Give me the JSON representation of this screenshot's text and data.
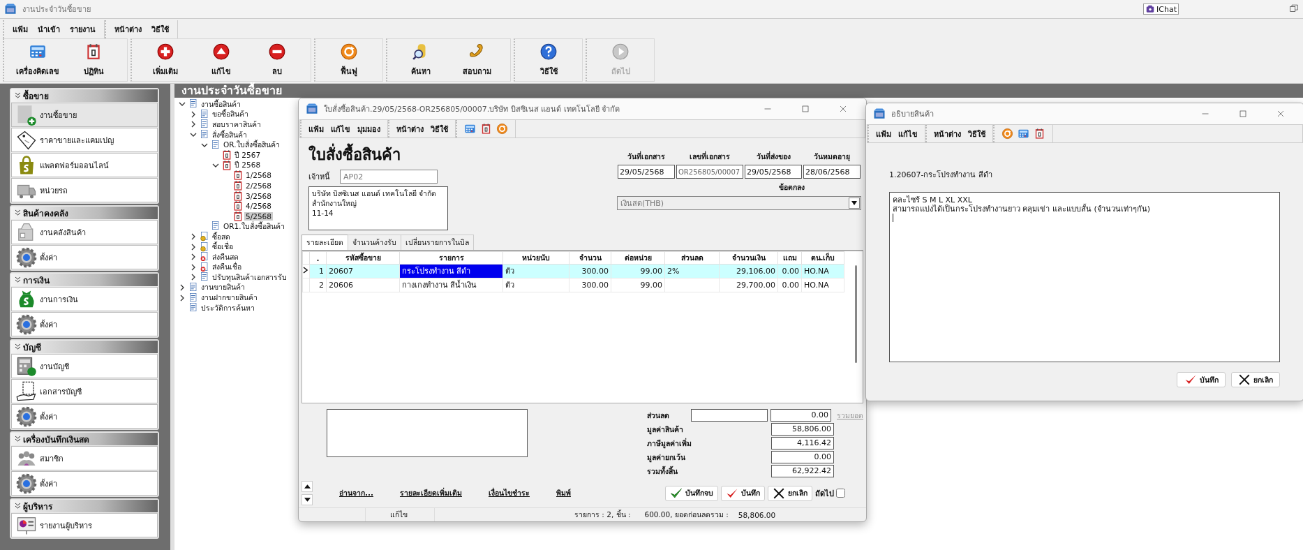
{
  "window": {
    "title": "งานประจำวันซื้อขาย",
    "chat_label": "IChat"
  },
  "menu_groups": [
    [
      "แฟ้ม",
      "นำเข้า",
      "รายงาน"
    ],
    [
      "หน้าต่าง",
      "วิธีใช้"
    ]
  ],
  "toolbar_groups": [
    [
      {
        "label": "เครื่องคิดเลข",
        "kind": "calculator",
        "disabled": false
      },
      {
        "label": "ปฏิทิน",
        "kind": "calendar",
        "disabled": false
      }
    ],
    [
      {
        "label": "เพิ่มเติม",
        "kind": "add",
        "disabled": false
      },
      {
        "label": "แก้ไข",
        "kind": "edit",
        "disabled": false
      },
      {
        "label": "ลบ",
        "kind": "delete",
        "disabled": false
      }
    ],
    [
      {
        "label": "ฟื้นฟู",
        "kind": "refresh",
        "disabled": false
      }
    ],
    [
      {
        "label": "ค้นหา",
        "kind": "search",
        "disabled": false
      },
      {
        "label": "สอบถาม",
        "kind": "phone",
        "disabled": false
      }
    ],
    [
      {
        "label": "วิธีใช้",
        "kind": "help",
        "disabled": false
      }
    ],
    [
      {
        "label": "ถัดไป",
        "kind": "next",
        "disabled": true
      }
    ]
  ],
  "sidebar": {
    "sections": [
      {
        "title": "ซื้อขาย",
        "items": [
          {
            "label": "งานซื้อขาย",
            "kind": "sale",
            "selected": true
          },
          {
            "label": "ราคาขายและแคมเปญ",
            "kind": "tag",
            "selected": false
          },
          {
            "label": "แพลตฟอร์มออนไลน์",
            "kind": "bag",
            "selected": false
          },
          {
            "label": "หน่วยรถ",
            "kind": "truck",
            "selected": false
          }
        ]
      },
      {
        "title": "สินค้าคงคลัง",
        "items": [
          {
            "label": "งานคลังสินค้า",
            "kind": "warehouse",
            "selected": false
          },
          {
            "label": "ตั้งค่า",
            "kind": "gear",
            "selected": false
          }
        ]
      },
      {
        "title": "การเงิน",
        "items": [
          {
            "label": "งานการเงิน",
            "kind": "money",
            "selected": false
          },
          {
            "label": "ตั้งค่า",
            "kind": "gear",
            "selected": false
          }
        ]
      },
      {
        "title": "บัญชี",
        "items": [
          {
            "label": "งานบัญชี",
            "kind": "ledger",
            "selected": false
          },
          {
            "label": "เอกสารบัญชี",
            "kind": "document",
            "selected": false
          },
          {
            "label": "ตั้งค่า",
            "kind": "gear",
            "selected": false
          }
        ]
      },
      {
        "title": "เครื่องบันทึกเงินสด",
        "items": [
          {
            "label": "สมาชิก",
            "kind": "members",
            "selected": false
          },
          {
            "label": "ตั้งค่า",
            "kind": "gear",
            "selected": false
          }
        ]
      },
      {
        "title": "ผู้บริหาร",
        "items": [
          {
            "label": "รายงานผู้บริหาร",
            "kind": "chart",
            "selected": false
          }
        ]
      }
    ]
  },
  "main_header": "งานประจำวันซื้อขาย",
  "tree": [
    {
      "label": "งานซื้อสินค้า",
      "kind": "doc",
      "expanded": true,
      "selected": false,
      "children": [
        {
          "label": "ขอซื้อสินค้า",
          "kind": "doc",
          "expanded": false,
          "selected": false
        },
        {
          "label": "สอบราคาสินค้า",
          "kind": "doc",
          "expanded": false,
          "selected": false
        },
        {
          "label": "สั่งซื้อสินค้า",
          "kind": "doc",
          "expanded": true,
          "selected": false,
          "children": [
            {
              "label": "OR.ใบสั่งซื้อสินค้า",
              "kind": "doc",
              "expanded": true,
              "selected": false,
              "children": [
                {
                  "label": "ปี 2567",
                  "kind": "calendar",
                  "selected": false
                },
                {
                  "label": "ปี 2568",
                  "kind": "calendar",
                  "expanded": true,
                  "selected": false,
                  "children": [
                    {
                      "label": "1/2568",
                      "kind": "calendar",
                      "selected": false
                    },
                    {
                      "label": "2/2568",
                      "kind": "calendar",
                      "selected": false
                    },
                    {
                      "label": "3/2568",
                      "kind": "calendar",
                      "selected": false
                    },
                    {
                      "label": "4/2568",
                      "kind": "calendar",
                      "selected": false
                    },
                    {
                      "label": "5/2568",
                      "kind": "calendar",
                      "selected": true
                    }
                  ]
                }
              ]
            },
            {
              "label": "OR1.ใบสั่งซื้อสินค้า",
              "kind": "doc",
              "selected": false
            }
          ]
        },
        {
          "label": "ซื้อสด",
          "kind": "coin",
          "expanded": false,
          "selected": false
        },
        {
          "label": "ซื้อเชื่อ",
          "kind": "coin",
          "expanded": false,
          "selected": false
        },
        {
          "label": "ส่งคืนสด",
          "kind": "return",
          "expanded": false,
          "selected": false
        },
        {
          "label": "ส่งคืนเชื่อ",
          "kind": "return",
          "expanded": false,
          "selected": false
        },
        {
          "label": "ปรับทุนสินค้าเอกสารรับ",
          "kind": "doc",
          "expanded": false,
          "selected": false
        }
      ]
    },
    {
      "label": "งานขายสินค้า",
      "kind": "doc",
      "expanded": false,
      "selected": false
    },
    {
      "label": "งานฝากขายสินค้า",
      "kind": "doc",
      "expanded": false,
      "selected": false
    },
    {
      "label": "ประวัติการค้นหา",
      "kind": "doc",
      "selected": false
    }
  ],
  "order_window": {
    "title": "ใบสั่งซื้อสินค้า.29/05/2568-OR256805/00007.บริษัท บิสซิเนส  แอนด์ เทคโนโลยี จำกัด",
    "menu_groups": [
      [
        "แฟ้ม",
        "แก้ไข",
        "มุมมอง"
      ],
      [
        "หน้าต่าง",
        "วิธีใช้"
      ]
    ],
    "tools": [
      {
        "kind": "calculator"
      },
      {
        "kind": "calendar"
      },
      {
        "kind": "refresh"
      }
    ],
    "heading": "ใบสั่งซื้อสินค้า",
    "creditor_label": "เจ้าหนี้",
    "creditor_value": "AP02",
    "address_lines": [
      "บริษัท บิสซิเนส  แอนด์ เทคโนโลยี จำกัด",
      "สำนักงานใหญ่",
      "11-14"
    ],
    "date_fields": [
      {
        "label": "วันที่เอกสาร",
        "value": "29/05/2568",
        "disabled": false
      },
      {
        "label": "เลขที่เอกสาร",
        "value": "OR256805/00007",
        "disabled": true
      },
      {
        "label": "วันที่ส่งของ",
        "value": "29/05/2568",
        "disabled": false
      },
      {
        "label": "วันหมดอายุ",
        "value": "28/06/2568",
        "disabled": false
      }
    ],
    "terms_label": "ข้อตกลง",
    "terms_value": "เงินสด(THB)",
    "tabs": [
      {
        "label": "รายละเอียด",
        "selected": true
      },
      {
        "label": "จำนวนค้างรับ",
        "selected": false
      },
      {
        "label": "เปลี่ยนรายการในบิล",
        "selected": false
      }
    ],
    "table": {
      "columns": [
        ".",
        "รหัสซื้อขาย",
        "รายการ",
        "หน่วยนับ",
        "จำนวน",
        "ต่อหน่วย",
        "ส่วนลด",
        "จำนวนเงิน",
        "แถม",
        "ตน.เก็บ"
      ],
      "rows": [
        {
          "selected": true,
          "cells": [
            {
              "text": "1",
              "focused": false
            },
            {
              "text": "20607",
              "focused": false
            },
            {
              "text": "กระโปรงทำงาน สีดำ",
              "focused": true
            },
            {
              "text": "ตัว",
              "focused": false
            },
            {
              "text": "300.00",
              "focused": false
            },
            {
              "text": "99.00",
              "focused": false
            },
            {
              "text": "2%",
              "focused": false
            },
            {
              "text": "29,106.00",
              "focused": false
            },
            {
              "text": "0.00",
              "focused": false
            },
            {
              "text": "HO.NA",
              "focused": false
            }
          ]
        },
        {
          "selected": false,
          "cells": [
            {
              "text": "2",
              "focused": false
            },
            {
              "text": "20606",
              "focused": false
            },
            {
              "text": "กางเกงทำงาน สีน้ำเงิน",
              "focused": false
            },
            {
              "text": "ตัว",
              "focused": false
            },
            {
              "text": "300.00",
              "focused": false
            },
            {
              "text": "99.00",
              "focused": false
            },
            {
              "focused": false
            },
            {
              "text": "29,700.00",
              "focused": false
            },
            {
              "text": "0.00",
              "focused": false
            },
            {
              "text": "HO.NA",
              "focused": false
            }
          ]
        }
      ]
    },
    "summary": [
      {
        "label": "ส่วนลด",
        "value": "0.00",
        "kind": "discount",
        "link": "รวมยอด"
      },
      {
        "label": "มูลค่าสินค้า",
        "value": "58,806.00",
        "kind": "plain"
      },
      {
        "label": "ภาษีมูลค่าเพิ่ม",
        "value": "4,116.42",
        "kind": "plain"
      },
      {
        "label": "มูลค่ายกเว้น",
        "value": "0.00",
        "kind": "plain"
      },
      {
        "label": "รวมทั้งสิ้น",
        "value": "62,922.42",
        "kind": "plain"
      }
    ],
    "links": [
      "อ่านจาก...",
      "รายละเอียดเพิ่มเติม",
      "เงื่อนไขชำระ",
      "พิมพ์"
    ],
    "buttons": [
      {
        "label": "บันทึกจบ",
        "kind": "save-close"
      },
      {
        "label": "บันทึก",
        "kind": "save"
      },
      {
        "label": "ยกเลิก",
        "kind": "cancel"
      }
    ],
    "next_checkbox": {
      "label": "ถัดไป",
      "checked": false
    },
    "status_bar": [
      "แก้ไข",
      "รายการ : 2, ชิ้น :",
      "600.00, ยอดก่อนลดรวม :",
      "58,806.00"
    ]
  },
  "description_window": {
    "title": "อธิบายสินค้า",
    "menu_groups": [
      [
        "แฟ้ม",
        "แก้ไข"
      ],
      [
        "หน้าต่าง",
        "วิธีใช้"
      ]
    ],
    "tools": [
      {
        "kind": "refresh"
      },
      {
        "kind": "calculator"
      },
      {
        "kind": "calendar"
      }
    ],
    "item_label": "1.20607-กระโปรงทำงาน สีดำ",
    "text_lines": [
      "คละไซร้ S M L XL XXL",
      "สามารถแบ่งได้เป็นกระโปรงทำงานยาว  คลุมเข่า และแบบสั้น  (จำนวนเท่าๆกัน)"
    ],
    "buttons": [
      {
        "label": "บันทึก",
        "kind": "save"
      },
      {
        "label": "ยกเลิก",
        "kind": "cancel"
      }
    ]
  }
}
